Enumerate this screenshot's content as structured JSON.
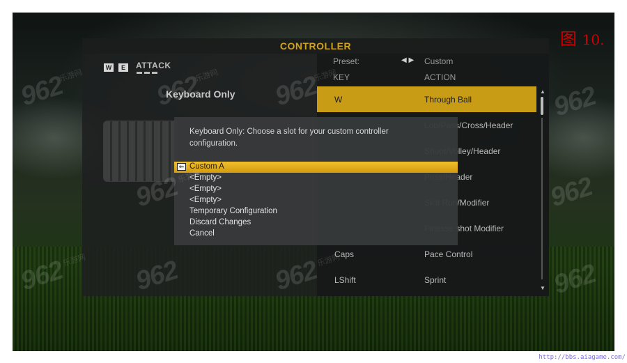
{
  "figure_label": {
    "prefix": "图",
    "number": "10."
  },
  "header": {
    "title": "CONTROLLER"
  },
  "left": {
    "key_badges": [
      "W",
      "E"
    ],
    "section_title": "ATTACK",
    "profile": "Keyboard Only"
  },
  "preset": {
    "label": "Preset:",
    "arrows": "◀ ▶",
    "value": "Custom"
  },
  "table": {
    "columns": [
      "KEY",
      "ACTION"
    ],
    "rows": [
      {
        "key": "W",
        "action": "Through Ball",
        "selected": true
      },
      {
        "key": "",
        "action": "Lob/Pass/Cross/Header"
      },
      {
        "key": "",
        "action": "Shoot/Volley/Header"
      },
      {
        "key": "",
        "action": "Pass/Header"
      },
      {
        "key": "",
        "action": "Skill Run/Modifier"
      },
      {
        "key": "",
        "action": "Finesse shot Modifier"
      },
      {
        "key": "Caps",
        "action": "Pace Control"
      },
      {
        "key": "LShift",
        "action": "Sprint"
      }
    ]
  },
  "dialog": {
    "prompt": "Keyboard Only: Choose a slot for your custom controller configuration.",
    "options": [
      {
        "label": "Custom A",
        "selected": true
      },
      {
        "label": "<Empty>"
      },
      {
        "label": "<Empty>"
      },
      {
        "label": "<Empty>"
      },
      {
        "label": "Temporary Configuration"
      },
      {
        "label": "Discard Changes"
      },
      {
        "label": "Cancel"
      }
    ]
  },
  "watermark": {
    "text": "962",
    "sub": "乐游网",
    "domain": ".net"
  },
  "footer": {
    "url": "http://bbs.aiagame.com/"
  },
  "colors": {
    "accent": "#c99c16",
    "title": "#d2a316",
    "figure_label": "#d10000"
  }
}
